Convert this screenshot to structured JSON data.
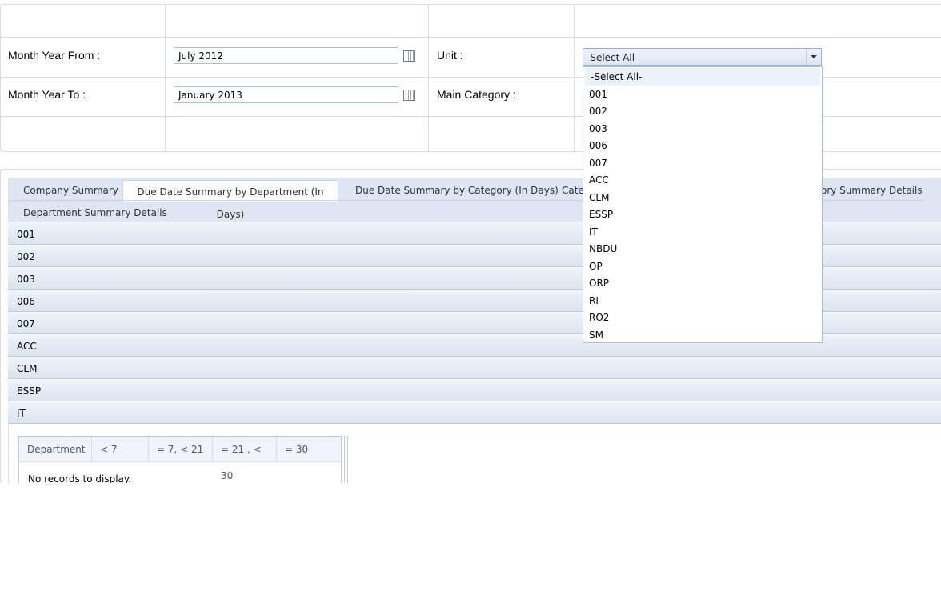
{
  "filters": {
    "month_from_label": "Month Year From :",
    "month_from_value": "July 2012",
    "month_to_label": "Month Year To :",
    "month_to_value": "January 2013",
    "unit_label": "Unit :",
    "unit_value": "-Select All-",
    "main_category_label": "Main Category :"
  },
  "unit_dropdown": {
    "options": [
      "-Select All-",
      "001",
      "002",
      "003",
      "006",
      "007",
      "ACC",
      "CLM",
      "ESSP",
      "IT",
      "NBDU",
      "OP",
      "ORP",
      "RI",
      "RO2",
      "SM"
    ],
    "selected": "-Select All-"
  },
  "tabs": [
    "Company Summary",
    "Due Date Summary by Department (In Days)",
    "Due Date Summary by Category (In Days)",
    "Categ",
    "ory Summary Details",
    "Department Summary Details"
  ],
  "active_tab": "Due Date Summary by Department (In Days)",
  "accordion": [
    "001",
    "002",
    "003",
    "006",
    "007",
    "ACC",
    "CLM",
    "ESSP",
    "IT"
  ],
  "grid": {
    "columns": [
      "Department",
      "< 7",
      "= 7, < 21",
      "= 21 , < 30",
      "= 30"
    ],
    "empty_text": "No records to display."
  }
}
